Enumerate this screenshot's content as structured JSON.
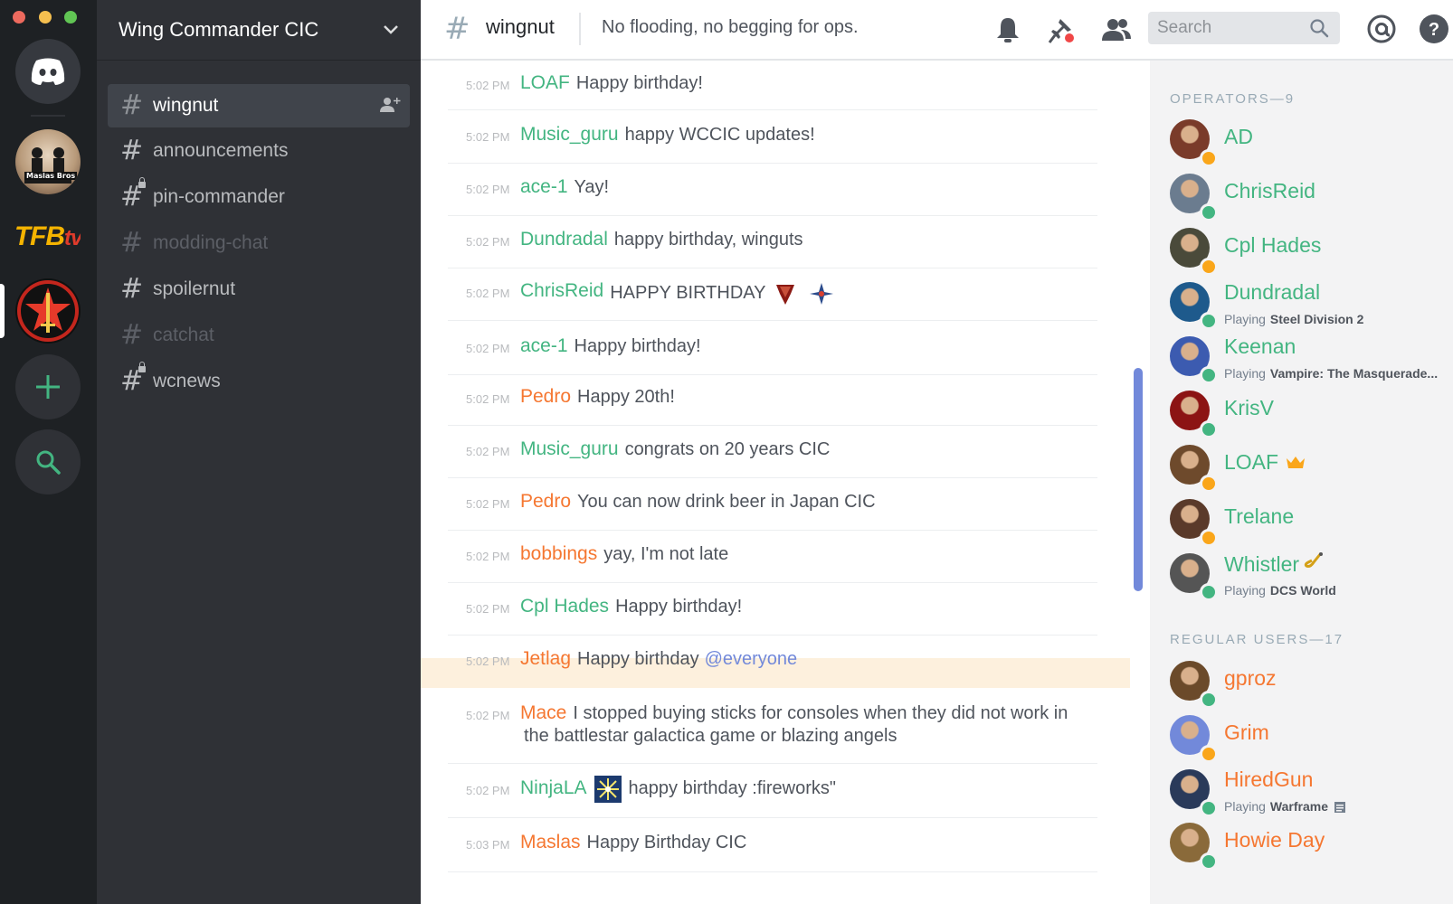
{
  "window": {
    "traffic_lights": [
      "#ed6a5e",
      "#f5bf4f",
      "#61c554"
    ]
  },
  "rail": {
    "servers": [
      {
        "name": "discord-home",
        "icon": "discord-logo-icon"
      },
      {
        "name": "maslas-bros",
        "label": "Maslas Bros"
      },
      {
        "name": "tfb-tv",
        "label": "TFB",
        "label_suffix": "tv"
      },
      {
        "name": "wing-commander-cic",
        "icon": "star-sword-icon"
      },
      {
        "name": "add-server",
        "icon": "plus-icon"
      },
      {
        "name": "explore",
        "icon": "search-icon"
      }
    ]
  },
  "server": {
    "name": "Wing Commander CIC"
  },
  "channels": [
    {
      "label": "wingnut",
      "state": "active",
      "locked": false
    },
    {
      "label": "announcements",
      "state": "normal",
      "locked": false
    },
    {
      "label": "pin-commander",
      "state": "normal",
      "locked": true
    },
    {
      "label": "modding-chat",
      "state": "muted",
      "locked": false
    },
    {
      "label": "spoilernut",
      "state": "normal",
      "locked": false
    },
    {
      "label": "catchat",
      "state": "muted",
      "locked": false
    },
    {
      "label": "wcnews",
      "state": "normal",
      "locked": true
    }
  ],
  "topbar": {
    "hash": "#",
    "channel": "wingnut",
    "topic": "No flooding, no begging for ops.",
    "search_placeholder": "Search"
  },
  "messages": [
    {
      "time": "5:02 PM",
      "author": "LOAF",
      "color": "green",
      "text": "Happy birthday!"
    },
    {
      "time": "5:02 PM",
      "author": "Music_guru",
      "color": "green",
      "text": "happy WCCIC updates!"
    },
    {
      "time": "5:02 PM",
      "author": "ace-1",
      "color": "green",
      "text": "Yay!"
    },
    {
      "time": "5:02 PM",
      "author": "Dundradal",
      "color": "green",
      "text": "happy birthday, winguts"
    },
    {
      "time": "5:02 PM",
      "author": "ChrisReid",
      "color": "green",
      "text": "HAPPY BIRTHDAY"
    },
    {
      "time": "5:02 PM",
      "author": "ace-1",
      "color": "green",
      "text": "Happy birthday!"
    },
    {
      "time": "5:02 PM",
      "author": "Pedro",
      "color": "orange",
      "text": "Happy 20th!"
    },
    {
      "time": "5:02 PM",
      "author": "Music_guru",
      "color": "green",
      "text": "congrats on 20 years CIC"
    },
    {
      "time": "5:02 PM",
      "author": "Pedro",
      "color": "orange",
      "text": "You can now drink beer in Japan CIC"
    },
    {
      "time": "5:02 PM",
      "author": "bobbings",
      "color": "orange",
      "text": "yay, I'm not late"
    },
    {
      "time": "5:02 PM",
      "author": "Cpl Hades",
      "color": "green",
      "text": "Happy birthday!"
    },
    {
      "time": "5:02 PM",
      "author": "Jetlag",
      "color": "orange",
      "text": "Happy birthday",
      "mention": "@everyone"
    },
    {
      "time": "5:02 PM",
      "author": "Mace",
      "color": "orange",
      "text": "I stopped buying sticks for consoles when they did not work in",
      "text2": "the battlestar galactica game or blazing angels"
    },
    {
      "time": "5:02 PM",
      "author": "NinjaLA",
      "color": "green",
      "text": "happy birthday :fireworks\""
    },
    {
      "time": "5:03 PM",
      "author": "Maslas",
      "color": "orange",
      "text": "Happy Birthday CIC"
    }
  ],
  "members": {
    "operators_header": "OPERATORS—9",
    "operators": [
      {
        "name": "AD",
        "color": "green",
        "status": "idle",
        "avatar": "#7a3b2a"
      },
      {
        "name": "ChrisReid",
        "color": "green",
        "status": "online",
        "avatar": "#6b7c8f"
      },
      {
        "name": "Cpl Hades",
        "color": "green",
        "status": "idle",
        "avatar": "#4a4a3a"
      },
      {
        "name": "Dundradal",
        "color": "green",
        "status": "online",
        "avatar": "#1e5a8c",
        "playing_prefix": "Playing",
        "game": "Steel Division 2"
      },
      {
        "name": "Keenan",
        "color": "green",
        "status": "online",
        "avatar": "#3c5bb0",
        "playing_prefix": "Playing",
        "game": "Vampire: The Masquerade..."
      },
      {
        "name": "KrisV",
        "color": "green",
        "status": "online",
        "avatar": "#8c1414"
      },
      {
        "name": "LOAF",
        "color": "green",
        "status": "idle",
        "avatar": "#6e4a2c",
        "badge": "crown-icon"
      },
      {
        "name": "Trelane",
        "color": "green",
        "status": "idle",
        "avatar": "#5a3a2a"
      },
      {
        "name": "Whistler",
        "color": "green",
        "status": "online",
        "avatar": "#555555",
        "badge": "saxophone-icon",
        "playing_prefix": "Playing",
        "game": "DCS World"
      }
    ],
    "regular_header": "REGULAR USERS—17",
    "regular": [
      {
        "name": "gproz",
        "color": "orange",
        "status": "online",
        "avatar": "#6b4a2a"
      },
      {
        "name": "Grim",
        "color": "orange",
        "status": "idle",
        "avatar": "#7289da"
      },
      {
        "name": "HiredGun",
        "color": "orange",
        "status": "online",
        "avatar": "#2a3a5a",
        "playing_prefix": "Playing",
        "game": "Warframe"
      },
      {
        "name": "Howie Day",
        "color": "orange",
        "status": "online",
        "avatar": "#8a6a3a"
      }
    ]
  }
}
